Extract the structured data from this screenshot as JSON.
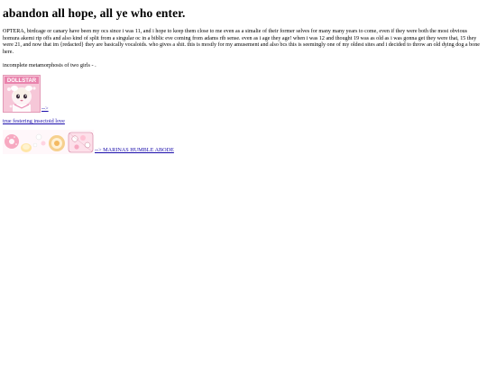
{
  "heading": "abandon all hope, all ye who enter.",
  "intro": "OPTERA, birdcage or canary have been my ocs since i was 11, and i hope to keep them close to me even as a simalie of their former selves for many many years to come, even if they were both the most obvious homura akemi rip offs and also kind of split from a singular oc in a biblic eve coming from adams rib sense. even as i age they age! when i was 12 and thought 19 was as old as i was gonna get they were that, 15 they were 21, and now that im {redacted} they are basically vocaloids. who gives a shit. this is mostly for my amusement and also bcs this is seemingly one of my oldest sites and i decided to throw an old dying dog a bone here.",
  "subtitle": "incomplete metamorphosis of two girls - .",
  "banner1": {
    "logo_text": "DOLLSTAR",
    "link_label": "-->"
  },
  "fester_link": "true festering insectoid love",
  "banner2": {
    "link_label": "--> MARINAS HUMBLE ABODE"
  },
  "colors": {
    "link": "#1a0dab",
    "banner1_bg": "#f6c7d8",
    "banner2_bg": "#fff7fa"
  }
}
